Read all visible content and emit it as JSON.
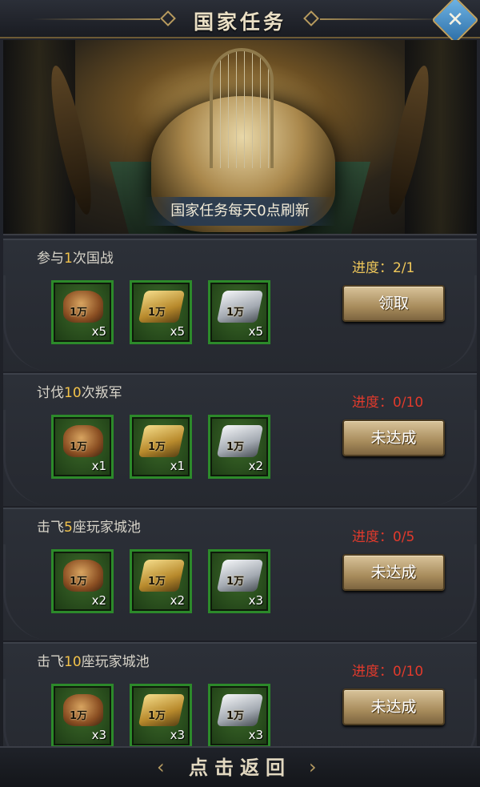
{
  "header": {
    "title": "国家任务",
    "close_icon": "close-icon"
  },
  "banner": {
    "caption": "国家任务每天0点刷新"
  },
  "tasks": [
    {
      "prefix": "参与",
      "count": "1",
      "suffix": "次国战",
      "progress": "进度：2/1",
      "progress_color": "#f0c85a",
      "button": "领取",
      "rewards": [
        {
          "icon": "food-icon",
          "label": "1万",
          "qty": "x5"
        },
        {
          "icon": "gold-icon",
          "label": "1万",
          "qty": "x5"
        },
        {
          "icon": "silver-icon",
          "label": "1万",
          "qty": "x5"
        }
      ]
    },
    {
      "prefix": "讨伐",
      "count": "10",
      "suffix": "次叛军",
      "progress": "进度：0/10",
      "progress_color": "#e23a2c",
      "button": "未达成",
      "rewards": [
        {
          "icon": "food-icon",
          "label": "1万",
          "qty": "x1"
        },
        {
          "icon": "gold-icon",
          "label": "1万",
          "qty": "x1"
        },
        {
          "icon": "silver-icon",
          "label": "1万",
          "qty": "x2"
        }
      ]
    },
    {
      "prefix": "击飞",
      "count": "5",
      "suffix": "座玩家城池",
      "progress": "进度：0/5",
      "progress_color": "#e23a2c",
      "button": "未达成",
      "rewards": [
        {
          "icon": "food-icon",
          "label": "1万",
          "qty": "x2"
        },
        {
          "icon": "gold-icon",
          "label": "1万",
          "qty": "x2"
        },
        {
          "icon": "silver-icon",
          "label": "1万",
          "qty": "x3"
        }
      ]
    },
    {
      "prefix": "击飞",
      "count": "10",
      "suffix": "座玩家城池",
      "progress": "进度：0/10",
      "progress_color": "#e23a2c",
      "button": "未达成",
      "rewards": [
        {
          "icon": "food-icon",
          "label": "1万",
          "qty": "x3"
        },
        {
          "icon": "gold-icon",
          "label": "1万",
          "qty": "x3"
        },
        {
          "icon": "silver-icon",
          "label": "1万",
          "qty": "x3"
        }
      ]
    }
  ],
  "footer": {
    "back_label": "点击返回"
  }
}
